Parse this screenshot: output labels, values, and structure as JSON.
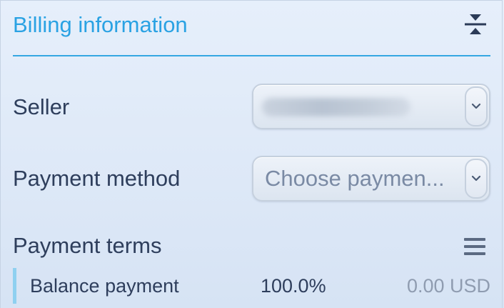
{
  "section": {
    "title": "Billing information",
    "collapse_icon": "collapse-vertical-icon"
  },
  "fields": {
    "seller": {
      "label": "Seller",
      "value_obscured": true
    },
    "payment_method": {
      "label": "Payment method",
      "placeholder": "Choose paymen..."
    }
  },
  "payment_terms": {
    "title": "Payment terms",
    "menu_icon": "hamburger-menu-icon",
    "rows": [
      {
        "name": "Balance payment",
        "percent": "100.0%",
        "amount": "0.00 USD"
      }
    ]
  },
  "colors": {
    "accent": "#2aa2e3",
    "text": "#2e3e5c",
    "muted": "#8f9cb0",
    "term_accent": "#8fd0f0"
  }
}
